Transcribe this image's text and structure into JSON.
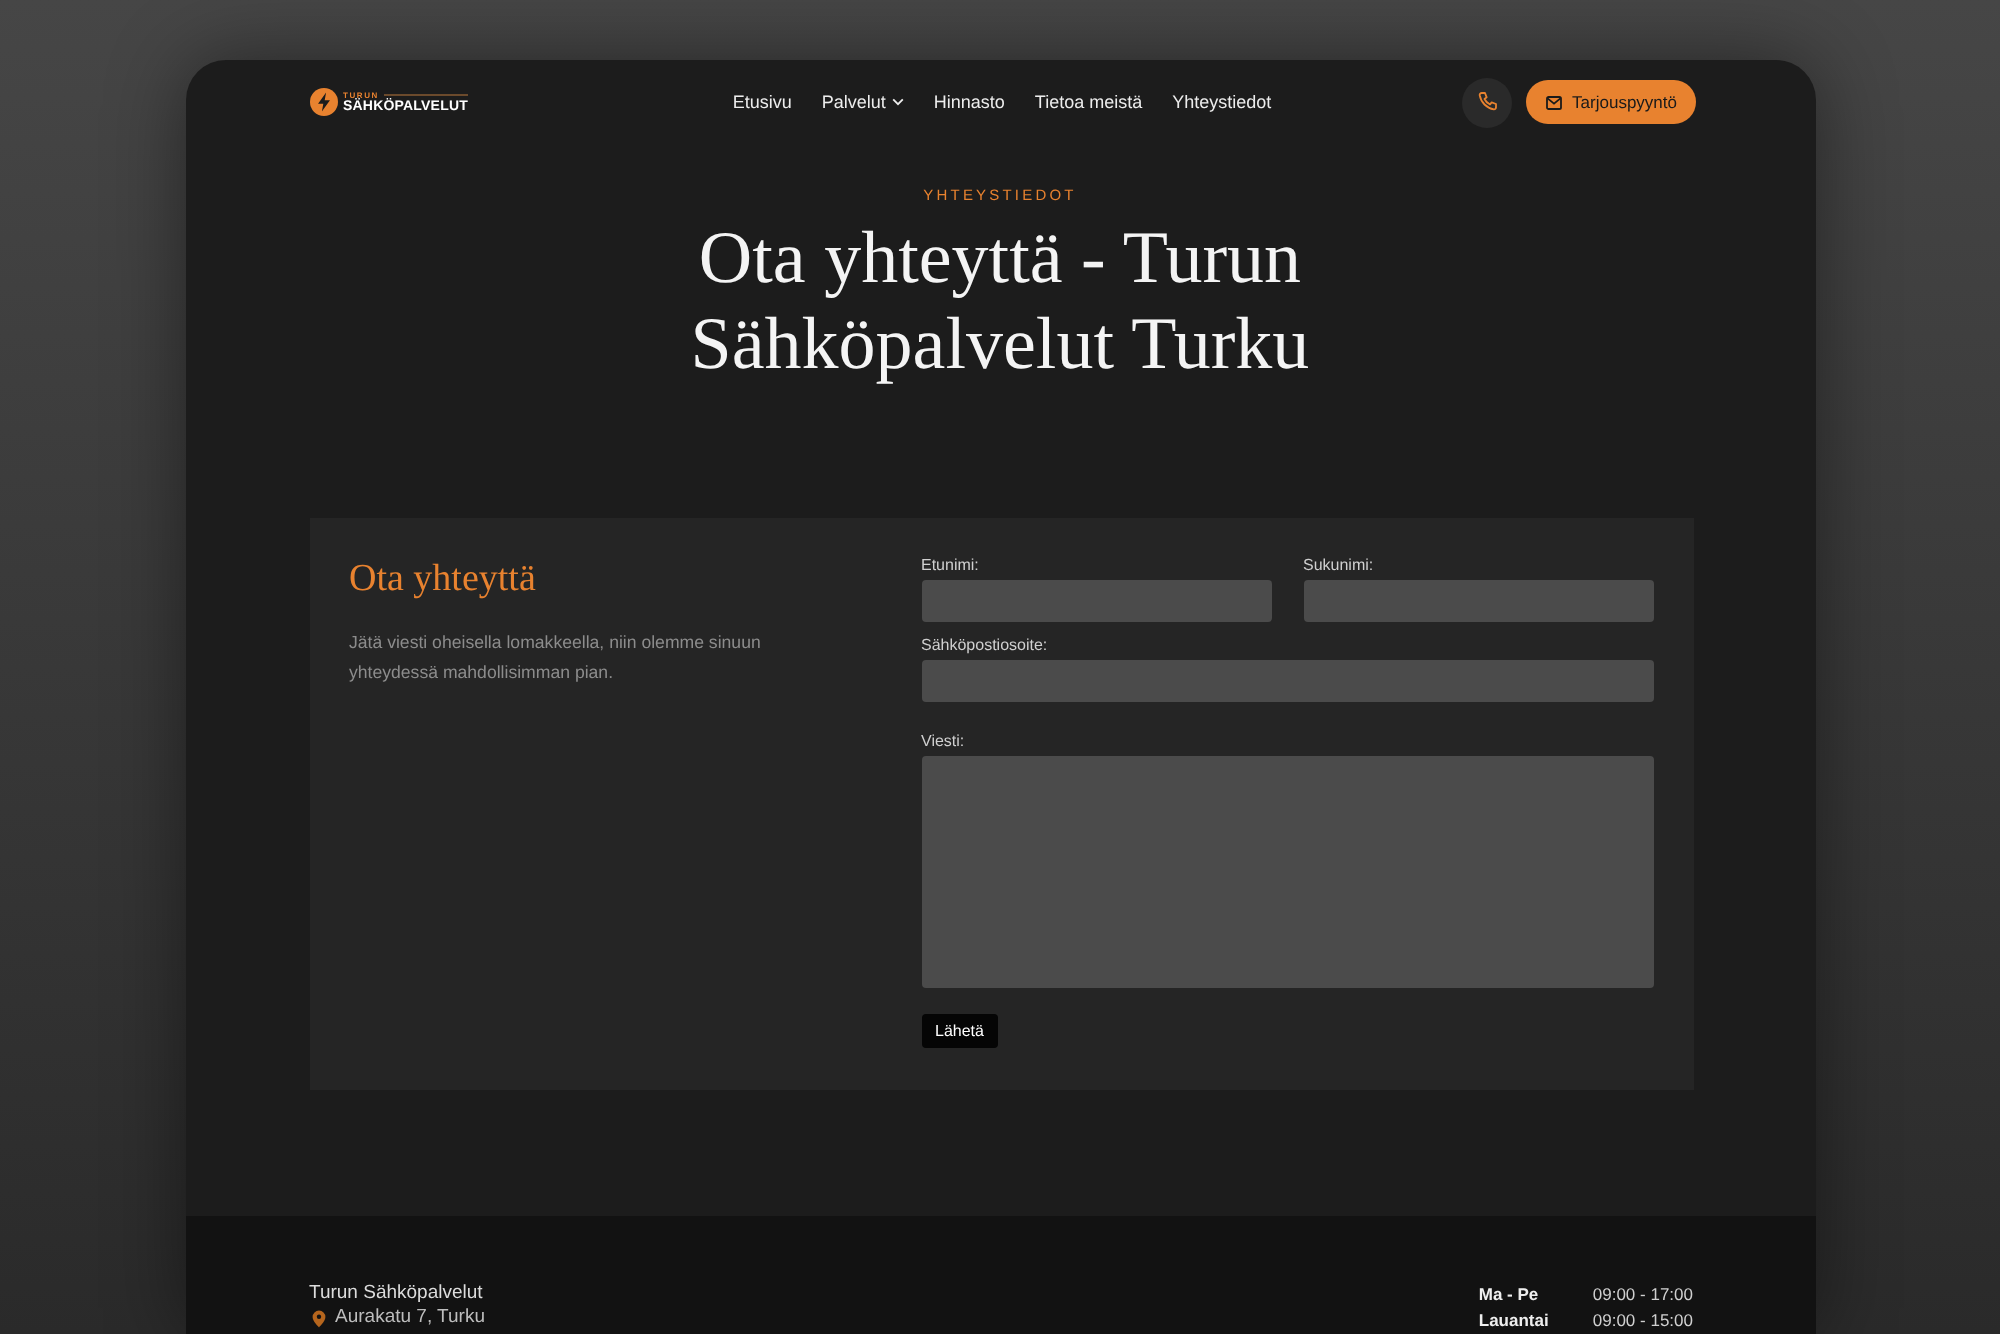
{
  "header": {
    "logo": {
      "tagline": "TURUN",
      "name": "SÄHKÖPALVELUT"
    },
    "nav": [
      {
        "label": "Etusivu",
        "selected": false,
        "dropdown": false
      },
      {
        "label": "Palvelut",
        "selected": false,
        "dropdown": true
      },
      {
        "label": "Hinnasto",
        "selected": false,
        "dropdown": false
      },
      {
        "label": "Tietoa meistä",
        "selected": false,
        "dropdown": false
      },
      {
        "label": "Yhteystiedot",
        "selected": false,
        "dropdown": false
      }
    ],
    "cta": {
      "label": "Tarjouspyyntö"
    }
  },
  "hero": {
    "eyebrow": "YHTEYSTIEDOT",
    "title": "Ota yhteyttä - Turun Sähköpalvelut Turku"
  },
  "contact_card": {
    "heading": "Ota yhteyttä",
    "text": "Jätä viesti oheisella lomakkeella, niin olemme sinuun yhteydessä mahdollisimman pian.",
    "form": {
      "fields": [
        {
          "label": "Etunimi:",
          "kind": "half"
        },
        {
          "label": "Sukunimi:",
          "kind": "half"
        },
        {
          "label": "Sähköpostiosoite:",
          "kind": "full"
        },
        {
          "label": "Viesti:",
          "kind": "textarea"
        }
      ],
      "submit": "Lähetä"
    }
  },
  "footer": {
    "company": "Turun Sähköpalvelut",
    "address": "Aurakatu 7, Turku",
    "hours": [
      {
        "days": "Ma - Pe",
        "time": "09:00 - 17:00"
      },
      {
        "days": "Lauantai",
        "time": "09:00 - 15:00"
      }
    ]
  }
}
